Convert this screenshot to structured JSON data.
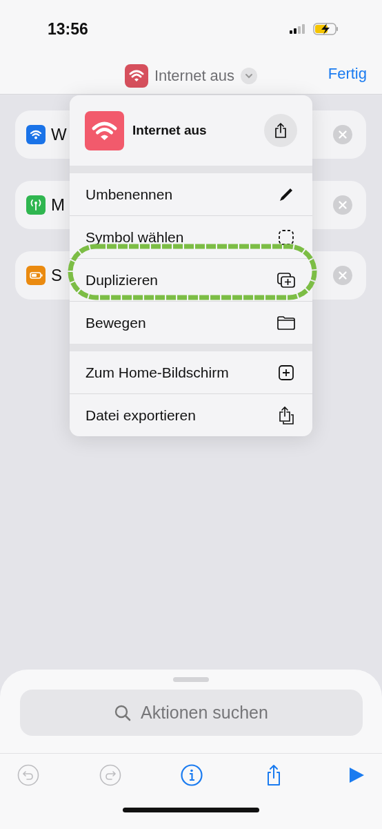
{
  "status_bar": {
    "time": "13:56"
  },
  "nav_bar": {
    "title": "Internet aus",
    "done": "Fertig"
  },
  "actions": [
    {
      "kind": "wifi",
      "color": "#1a73e8",
      "text": "W"
    },
    {
      "kind": "antenna",
      "color": "#30b650",
      "text": "M"
    },
    {
      "kind": "battery",
      "color": "#ea8a10",
      "text": "S"
    }
  ],
  "menu": {
    "title": "Internet aus",
    "groups": [
      {
        "items": [
          {
            "kind": "pencil",
            "label": "Umbenennen",
            "highlighted": false
          },
          {
            "kind": "dashed-square",
            "label": "Symbol wählen",
            "highlighted": false
          },
          {
            "kind": "duplicate",
            "label": "Duplizieren",
            "highlighted": true
          },
          {
            "kind": "folder",
            "label": "Bewegen",
            "highlighted": false
          }
        ]
      },
      {
        "items": [
          {
            "kind": "plus-square",
            "label": "Zum Home-Bildschirm",
            "highlighted": false
          },
          {
            "kind": "export",
            "label": "Datei exportieren",
            "highlighted": false
          }
        ]
      }
    ]
  },
  "search": {
    "placeholder": "Aktionen suchen"
  },
  "toolbar": [
    {
      "kind": "undo",
      "disabled": true
    },
    {
      "kind": "redo",
      "disabled": true
    },
    {
      "kind": "info",
      "disabled": false
    },
    {
      "kind": "share",
      "disabled": false
    },
    {
      "kind": "play",
      "disabled": false
    }
  ]
}
